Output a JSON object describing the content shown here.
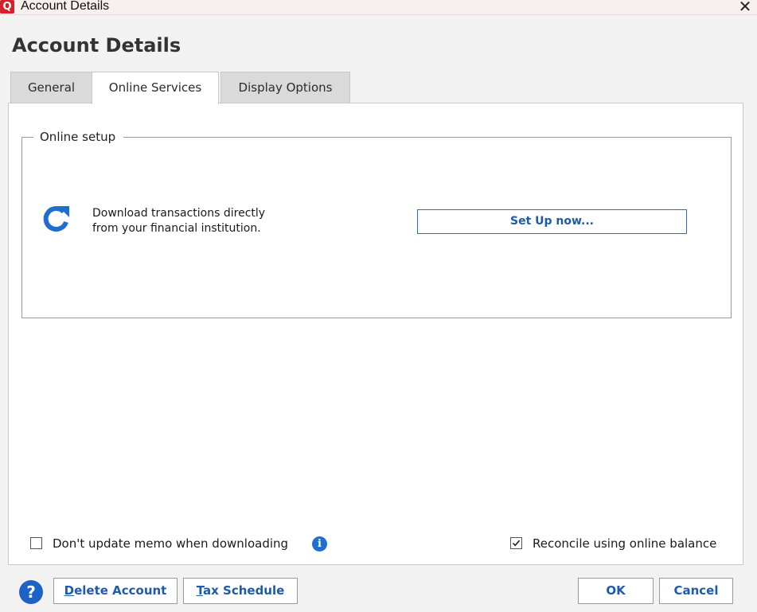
{
  "window": {
    "title": "Account Details",
    "app_icon_letter": "Q",
    "close_glyph": "✕"
  },
  "heading": "Account Details",
  "tabs": [
    {
      "label": "General",
      "active": false
    },
    {
      "label": "Online Services",
      "active": true
    },
    {
      "label": "Display Options",
      "active": false
    }
  ],
  "online_setup": {
    "legend": "Online setup",
    "icon": "refresh-icon",
    "description": "Download transactions directly from your financial institution.",
    "setup_button": "Set Up now..."
  },
  "options": {
    "dont_update_memo": {
      "label": "Don't update memo when downloading",
      "checked": false
    },
    "reconcile_online": {
      "label": "Reconcile using online balance",
      "checked": true
    }
  },
  "footer": {
    "help_glyph": "?",
    "info_glyph": "i",
    "delete_account": {
      "first": "D",
      "rest": "elete Account"
    },
    "tax_schedule": {
      "first": "T",
      "rest": "ax Schedule"
    },
    "ok": "OK",
    "cancel": "Cancel"
  },
  "colors": {
    "accent": "#1f5aa8",
    "brand_red": "#d3202a",
    "info_blue": "#1f6fd1"
  }
}
